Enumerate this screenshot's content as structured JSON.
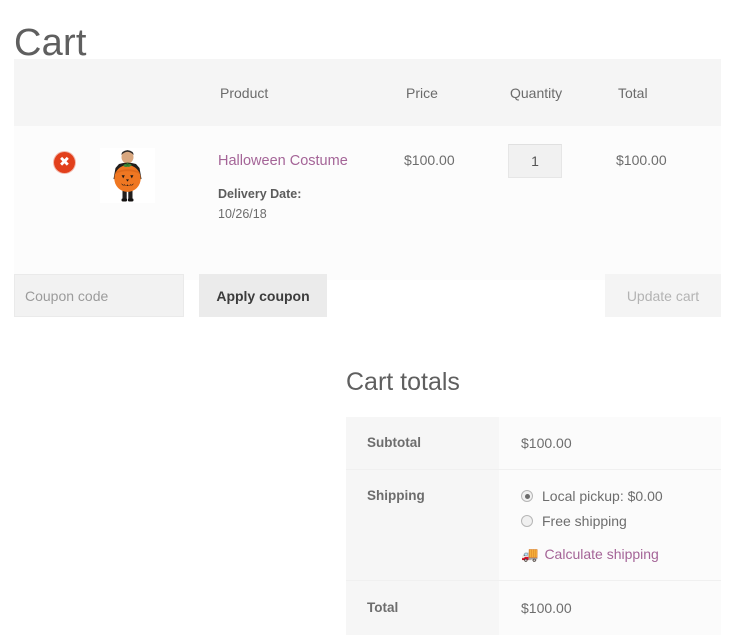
{
  "page": {
    "title": "Cart"
  },
  "cart_table": {
    "headers": {
      "remove": "",
      "thumbnail": "",
      "product": "Product",
      "price": "Price",
      "quantity": "Quantity",
      "total": "Total"
    },
    "items": [
      {
        "remove_icon": "remove-x-icon",
        "remove_glyph": "✖",
        "thumbnail_alt": "halloween-costume-thumbnail",
        "name": "Halloween Costume",
        "meta_label": "Delivery Date:",
        "meta_value": "10/26/18",
        "price": "$100.00",
        "quantity": "1",
        "total": "$100.00"
      }
    ]
  },
  "coupon": {
    "placeholder": "Coupon code",
    "value": "",
    "apply_label": "Apply coupon",
    "update_label": "Update cart",
    "update_disabled": true
  },
  "cart_totals": {
    "heading": "Cart totals",
    "subtotal_label": "Subtotal",
    "subtotal_value": "$100.00",
    "shipping_label": "Shipping",
    "shipping_methods": [
      {
        "label": "Local pickup: $0.00",
        "selected": true
      },
      {
        "label": "Free shipping",
        "selected": false
      }
    ],
    "calculate_shipping_label": "Calculate shipping",
    "truck_icon": "🚚",
    "total_label": "Total",
    "total_value": "$100.00"
  },
  "colors": {
    "link_purple": "#a46497",
    "remove_red": "#e2401c",
    "header_bg": "#f5f5f5",
    "body_bg": "#fcfcfc",
    "text": "#6d6d6d"
  }
}
